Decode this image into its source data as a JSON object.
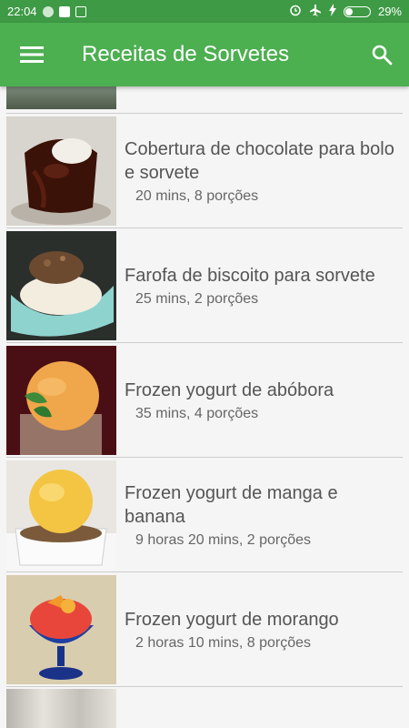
{
  "status_bar": {
    "time": "22:04",
    "battery": "29%",
    "battery_level": 0.29,
    "icons": [
      "chrome-icon",
      "download-icon",
      "android-icon",
      "alarm-icon",
      "airplane-icon",
      "charging-icon",
      "battery-icon"
    ]
  },
  "app_bar": {
    "title": "Receitas de Sorvetes",
    "menu_icon": "hamburger-menu-icon",
    "search_icon": "search-icon"
  },
  "recipes": [
    {
      "name": "Cobertura de chocolate para bolo e sorvete",
      "meta": "20 mins, 8 porções"
    },
    {
      "name": "Farofa de biscoito para sorvete",
      "meta": "25 mins, 2 porções"
    },
    {
      "name": "Frozen yogurt de abóbora",
      "meta": "35 mins, 4 porções"
    },
    {
      "name": "Frozen yogurt de manga e banana",
      "meta": "9 horas 20 mins, 2 porções"
    },
    {
      "name": "Frozen yogurt de morango",
      "meta": "2 horas 10 mins, 8 porções"
    }
  ],
  "colors": {
    "status_bar": "#3e9a45",
    "app_bar": "#4caf50",
    "background": "#f5f5f5"
  }
}
